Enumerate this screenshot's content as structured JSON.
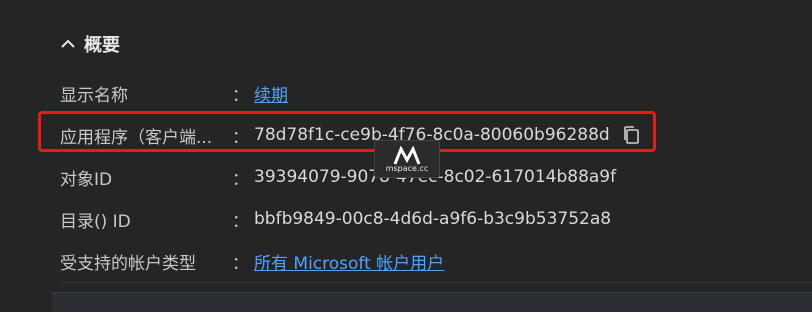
{
  "section": {
    "title": "概要",
    "icon": "chevron-up-icon"
  },
  "rows": [
    {
      "label": "显示名称",
      "colon": "：",
      "value": "续期",
      "is_link": true
    },
    {
      "label": "应用程序（客户端...",
      "colon": "：",
      "value": "78d78f1c-ce9b-4f76-8c0a-80060b96288d",
      "is_link": false
    },
    {
      "label": "对象ID",
      "colon": "：",
      "value": "39394079-9078-47ec-8c02-617014b88a9f",
      "is_link": false
    },
    {
      "label": "目录() ID",
      "colon": "：",
      "value": "bbfb9849-00c8-4d6d-a9f6-b3c9b53752a8",
      "is_link": false
    },
    {
      "label": "受支持的帐户类型",
      "colon": "：",
      "value": "所有 Microsoft 帐户用户",
      "is_link": true
    }
  ],
  "copy_icon": "copy-icon",
  "watermark": {
    "text": "mspace.cc"
  },
  "colors": {
    "background": "#252526",
    "link": "#4da3ff",
    "highlight": "#e51c1c"
  }
}
